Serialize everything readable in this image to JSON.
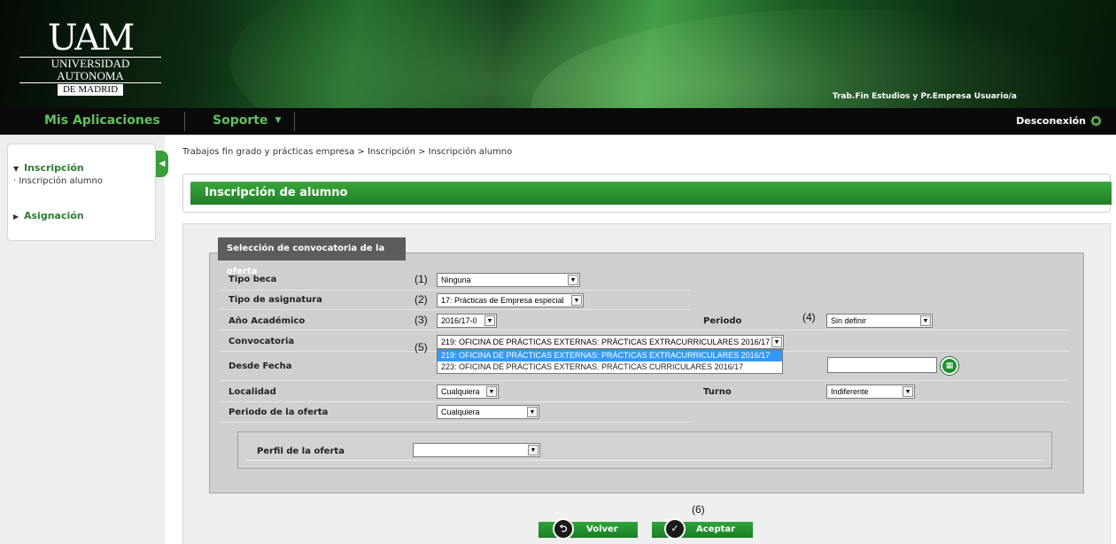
{
  "header": {
    "logo_mark": "UAM",
    "logo_line1": "UNIVERSIDAD AUTONOMA",
    "logo_line2": "DE MADRID",
    "user_label": "Trab.Fin Estudios y Pr.Empresa  Usuario/a"
  },
  "topnav": {
    "apps": "Mis Aplicaciones",
    "support": "Soporte",
    "logout": "Desconexión"
  },
  "sidebar": {
    "items": [
      {
        "label": "Inscripción",
        "expanded": true
      },
      {
        "label": "· Inscripción alumno"
      },
      {
        "label": "Asignación",
        "expanded": false
      }
    ]
  },
  "breadcrumb": "Trabajos fin grado y prácticas empresa > Inscripción > Inscripción alumno",
  "page_title": "Inscripción de alumno",
  "legend": "Selección de convocatoria de la oferta",
  "form": {
    "tipo_beca": {
      "label": "Tipo beca",
      "num": "(1)",
      "value": "Ninguna"
    },
    "tipo_asignatura": {
      "label": "Tipo de asignatura",
      "num": "(2)",
      "value": "17: Prácticas de Empresa especial"
    },
    "anio": {
      "label": "Año Académico",
      "num": "(3)",
      "value": "2016/17-0"
    },
    "periodo": {
      "label": "Periodo",
      "num": "(4)",
      "value": "Sin definir"
    },
    "convocatoria": {
      "label": "Convocatoria",
      "num": "(5)",
      "value": "219: OFICINA DE PRÁCTICAS EXTERNAS: PRÁCTICAS EXTRACURRICULARES 2016/17",
      "options": [
        "219: OFICINA DE PRÁCTICAS EXTERNAS: PRÁCTICAS EXTRACURRICULARES 2016/17",
        "223: OFICINA DE PRÁCTICAS EXTERNAS. PRÁCTICAS CURRICULARES 2016/17"
      ]
    },
    "desde_fecha": {
      "label": "Desde Fecha"
    },
    "localidad": {
      "label": "Localidad",
      "value": "Cualquiera"
    },
    "turno": {
      "label": "Turno",
      "value": "Indiferente"
    },
    "periodo_oferta": {
      "label": "Periodo de la oferta",
      "value": "Cualquiera"
    },
    "perfil": {
      "label": "Perfil de la oferta",
      "value": ""
    }
  },
  "buttons": {
    "num": "(6)",
    "volver": "Volver",
    "aceptar": "Aceptar"
  },
  "colors": {
    "accent_green": "#2e9b38",
    "nav_text_green": "#5fc15c",
    "dropdown_highlight": "#3399ff"
  }
}
